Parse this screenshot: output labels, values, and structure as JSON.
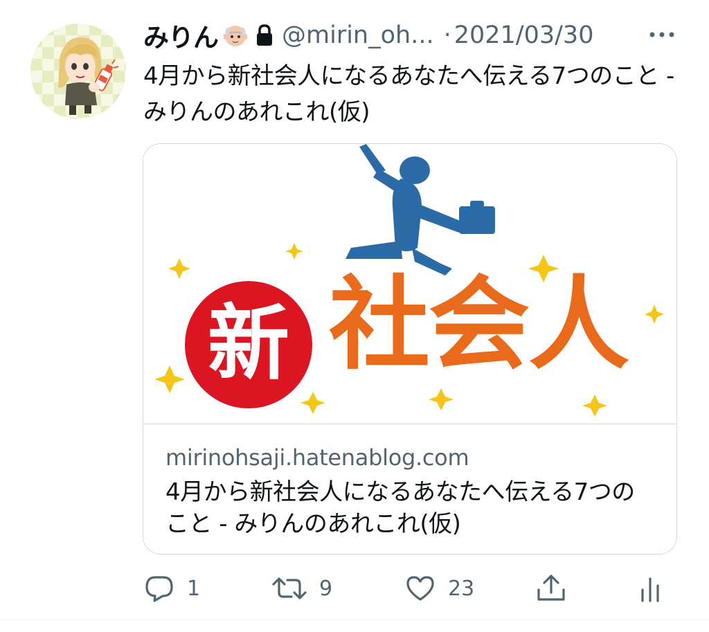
{
  "tweet": {
    "author_name": "みりん",
    "handle": "@mirin_oh...",
    "separator": "·",
    "date": "2021/03/30",
    "text": "4月から新社会人になるあなたへ伝える7つのこと - みりんのあれこれ(仮)",
    "icons": {
      "avatar": "avatar",
      "author_emoji": "old-man-emoji",
      "protected": "lock-icon",
      "more": "more-icon"
    }
  },
  "card": {
    "image_name": "new-employee-illustration",
    "domain": "mirinohsaji.hatenablog.com",
    "title": "4月から新社会人になるあなたへ伝える7つのこと - みりんのあれこれ(仮)"
  },
  "actions": {
    "reply_count": "1",
    "retweet_count": "9",
    "like_count": "23",
    "icons": [
      "reply-icon",
      "retweet-icon",
      "like-icon",
      "share-icon",
      "analytics-icon"
    ]
  },
  "colors": {
    "text": "#0f1419",
    "secondary": "#536471",
    "border": "#cfd9de",
    "jumper_blue": "#2a6aa7",
    "kanji_orange": "#ea6a1c",
    "badge_red": "#dc1522",
    "star_yellow": "#f5c518"
  },
  "illustration": {
    "badge_text": "新",
    "kanji_text": "社会人"
  }
}
